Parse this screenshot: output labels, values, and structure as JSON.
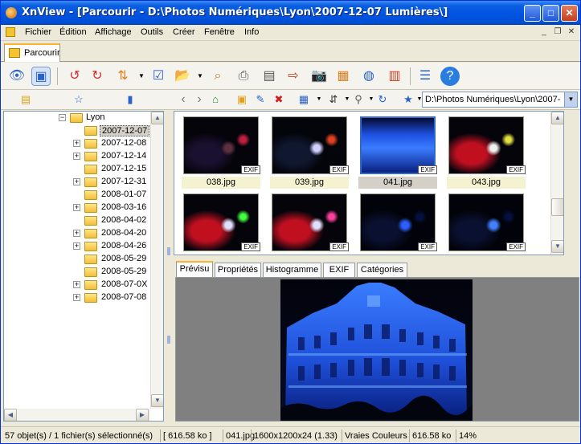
{
  "window": {
    "title": "XnView - [Parcourir - D:\\Photos Numériques\\Lyon\\2007-12-07 Lumières\\]",
    "minimize": "_",
    "maximize": "□",
    "close": "✕"
  },
  "menu": {
    "items": [
      "Fichier",
      "Édition",
      "Affichage",
      "Outils",
      "Créer",
      "Fenêtre",
      "Info"
    ]
  },
  "tabs": {
    "browse": "Parcourir"
  },
  "address": {
    "path": "D:\\Photos Numériques\\Lyon\\2007-"
  },
  "tree": {
    "root": "Lyon",
    "items": [
      {
        "label": "2007-12-07",
        "expand": "",
        "selected": true
      },
      {
        "label": "2007-12-08",
        "expand": "+"
      },
      {
        "label": "2007-12-14",
        "expand": "+"
      },
      {
        "label": "2007-12-15",
        "expand": ""
      },
      {
        "label": "2007-12-31",
        "expand": "+"
      },
      {
        "label": "2008-01-07",
        "expand": ""
      },
      {
        "label": "2008-03-16",
        "expand": "+"
      },
      {
        "label": "2008-04-02",
        "expand": ""
      },
      {
        "label": "2008-04-20",
        "expand": "+"
      },
      {
        "label": "2008-04-26",
        "expand": "+"
      },
      {
        "label": "2008-05-29",
        "expand": ""
      },
      {
        "label": "2008-05-29",
        "expand": ""
      },
      {
        "label": "2008-07-0X",
        "expand": "+"
      },
      {
        "label": "2008-07-08",
        "expand": "+"
      }
    ]
  },
  "thumbnails": [
    {
      "name": "038.jpg",
      "exif": "EXIF",
      "selected": false
    },
    {
      "name": "039.jpg",
      "exif": "EXIF",
      "selected": false
    },
    {
      "name": "041.jpg",
      "exif": "EXIF",
      "selected": true
    },
    {
      "name": "043.jpg",
      "exif": "EXIF",
      "selected": false
    },
    {
      "name": "",
      "exif": "EXIF",
      "selected": false
    },
    {
      "name": "",
      "exif": "EXIF",
      "selected": false
    },
    {
      "name": "",
      "exif": "EXIF",
      "selected": false
    },
    {
      "name": "",
      "exif": "EXIF",
      "selected": false
    }
  ],
  "preview_tabs": [
    "Prévisu",
    "Propriétés",
    "Histogramme",
    "EXIF",
    "Catégories"
  ],
  "status": {
    "objects": "57 objet(s) / 1 fichier(s) sélectionné(s)",
    "selsize": "[ 616.58 ko ]",
    "file": "041.jpg",
    "dims": "1600x1200x24 (1.33)",
    "colors": "Vraies Couleurs",
    "size": "616.58 ko",
    "zoom": "14%"
  },
  "colors": {
    "title_bar": "#0053e1",
    "selection": "#316ac5",
    "caption_bg": "#f5f2d2"
  }
}
